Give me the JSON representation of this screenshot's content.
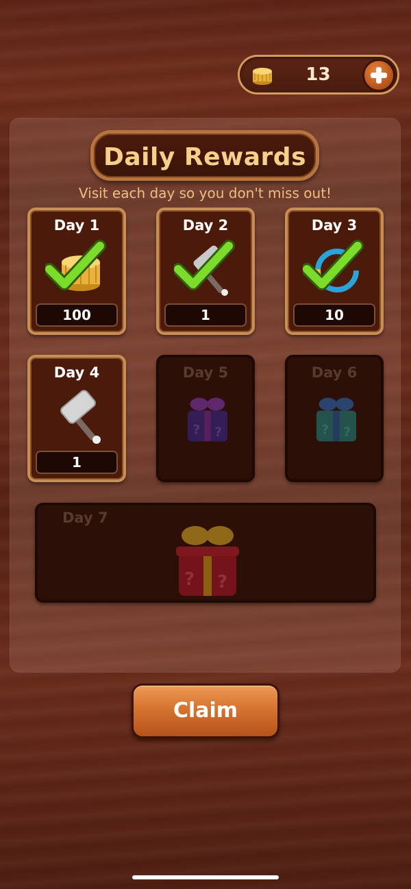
{
  "currency": {
    "count": "13",
    "icon": "coin-stack-icon",
    "plus_icon": "plus-icon"
  },
  "header": {
    "title": "Daily Rewards",
    "subtitle": "Visit each day so you don't miss out!"
  },
  "days": [
    {
      "label": "Day 1",
      "amount": "100",
      "reward": "coins",
      "state": "claimed"
    },
    {
      "label": "Day 2",
      "amount": "1",
      "reward": "hammer",
      "state": "claimed"
    },
    {
      "label": "Day 3",
      "amount": "10",
      "reward": "booster",
      "state": "claimed"
    },
    {
      "label": "Day 4",
      "amount": "1",
      "reward": "hammer",
      "state": "available"
    },
    {
      "label": "Day 5",
      "reward": "purple-gift",
      "state": "locked"
    },
    {
      "label": "Day 6",
      "reward": "teal-gift",
      "state": "locked"
    },
    {
      "label": "Day 7",
      "reward": "red-gift",
      "state": "locked"
    }
  ],
  "actions": {
    "claim_label": "Claim"
  },
  "colors": {
    "accent_orange": "#d67430",
    "title_gold": "#f6cf8a",
    "check_green": "#7ddb2c"
  }
}
